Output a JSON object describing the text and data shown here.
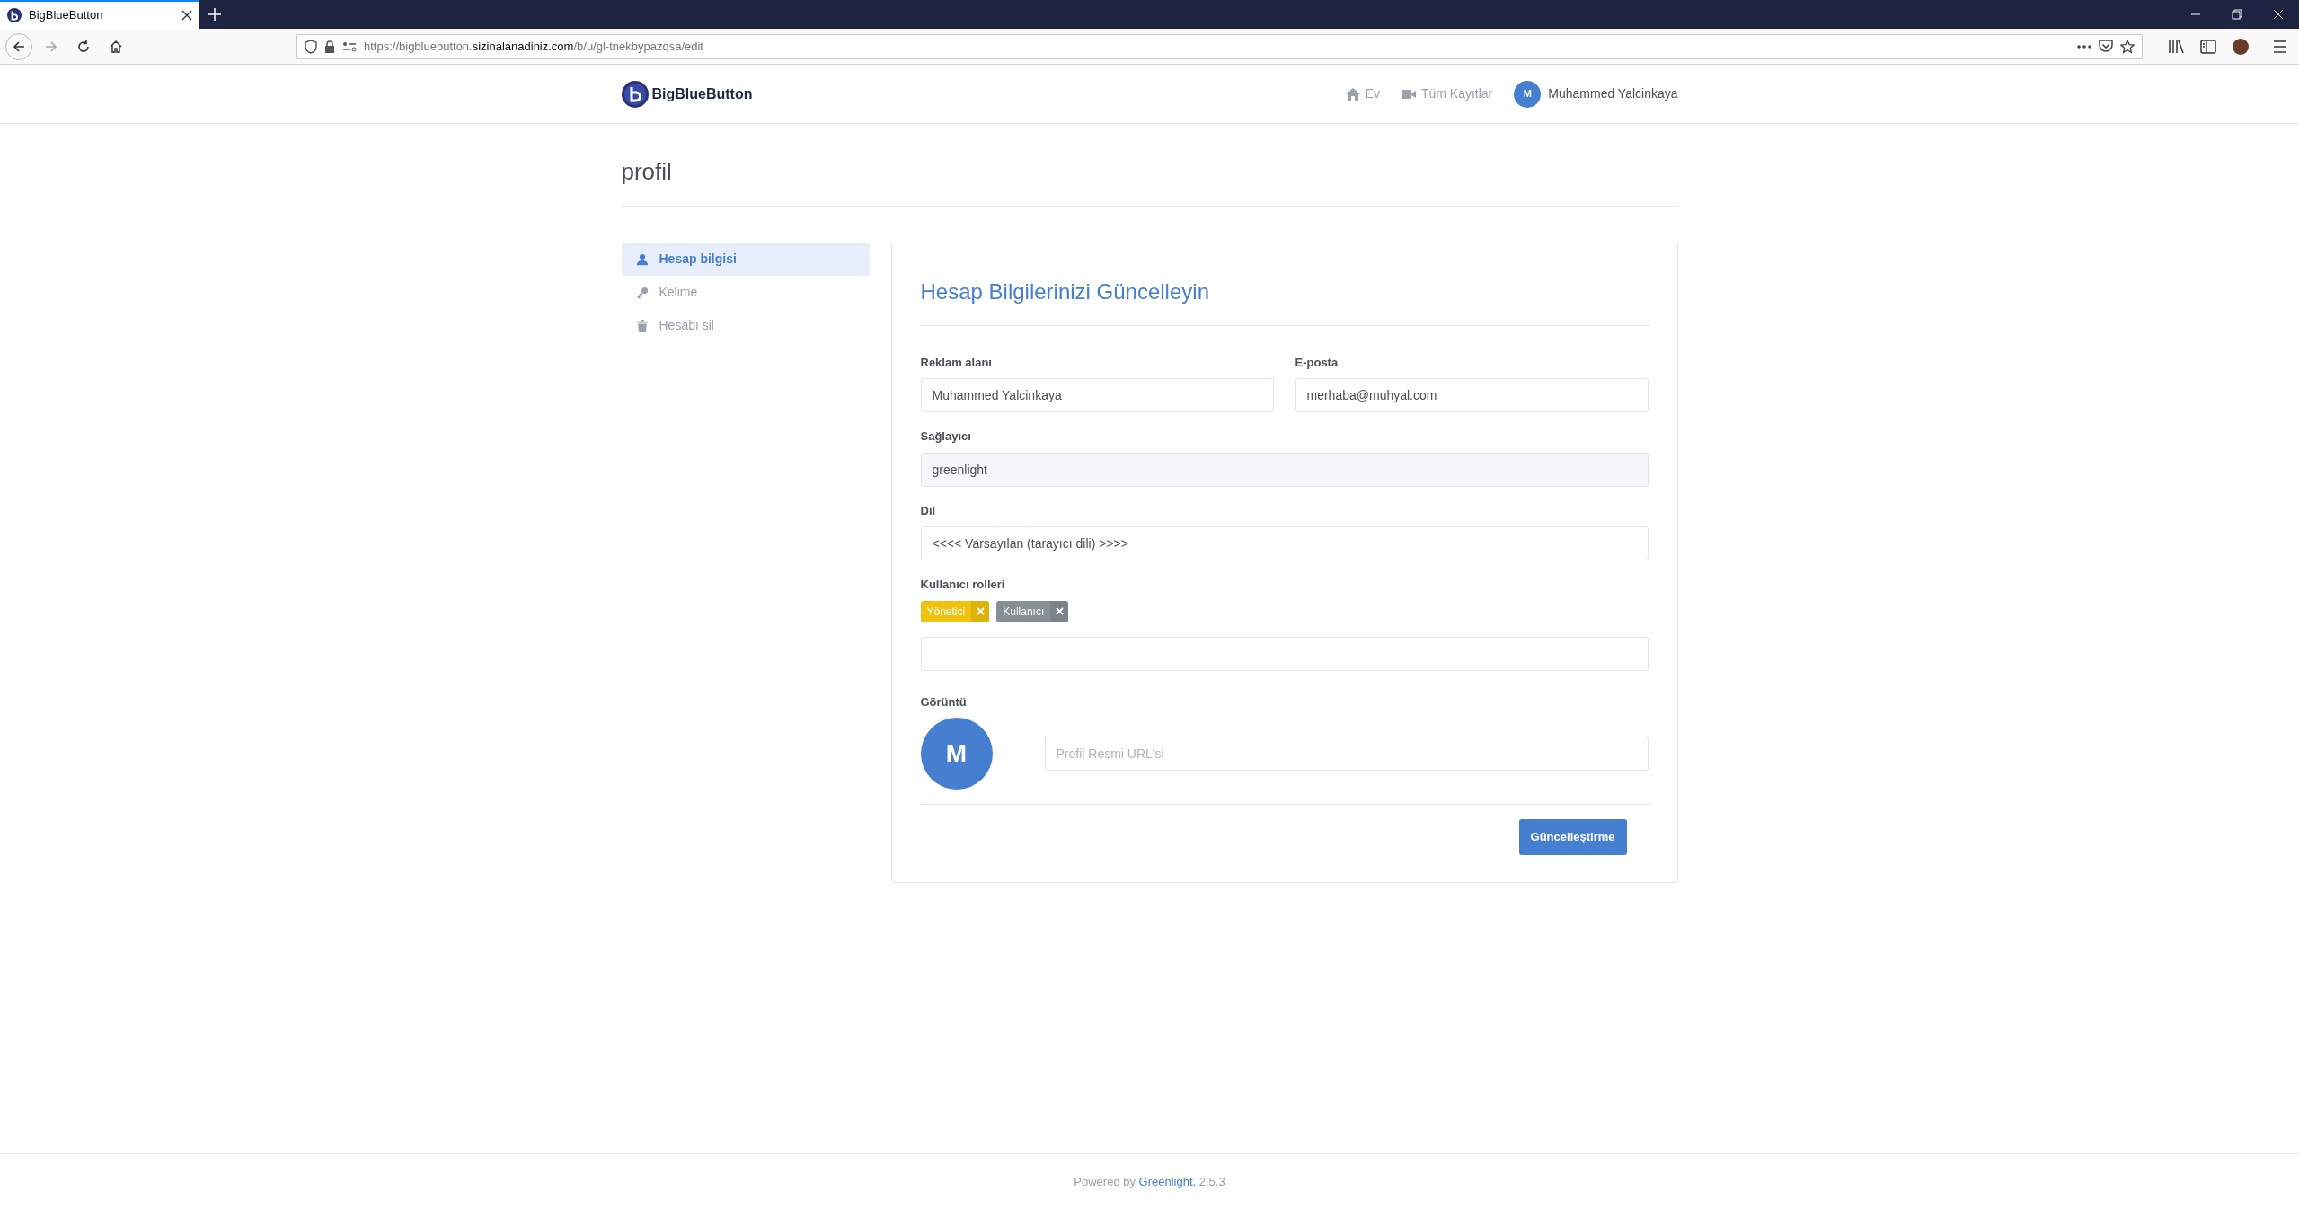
{
  "browser": {
    "tab_title": "BigBlueButton",
    "url": {
      "before": "https://bigbluebutton.",
      "domain": "sizinalanadiniz.com",
      "after": "/b/u/gl-tnekbypazqsa/edit"
    }
  },
  "navbar": {
    "brand": "BigBlueButton",
    "links": [
      {
        "label": "Ev"
      },
      {
        "label": "Tüm Kayıtlar"
      }
    ],
    "user": {
      "initial": "M",
      "name": "Muhammed Yalcinkaya"
    }
  },
  "page_title": "profil",
  "sidebar": {
    "items": [
      {
        "label": "Hesap bilgisi",
        "selected": true
      },
      {
        "label": "Kelime",
        "selected": false
      },
      {
        "label": "Hesabı sil",
        "selected": false
      }
    ]
  },
  "form": {
    "title": "Hesap Bilgilerinizi Güncelleyin",
    "rows": [
      [
        {
          "label": "Reklam alanı",
          "kind": "text",
          "value": "Muhammed Yalcinkaya"
        },
        {
          "label": "E-posta",
          "kind": "text",
          "value": "merhaba@muhyal.com"
        }
      ],
      [
        {
          "label": "Sağlayıcı",
          "kind": "readonly",
          "value": "greenlight"
        }
      ],
      [
        {
          "label": "Dil",
          "kind": "select",
          "value": "<<<< Varsayılan (tarayıcı dili) >>>>"
        }
      ]
    ],
    "roles": {
      "label": "Kullanıcı rolleri",
      "tags": [
        {
          "label": "Yönetici",
          "color": "#f0c20e"
        },
        {
          "label": "Kullanıcı",
          "color": "#868e96"
        }
      ]
    },
    "image": {
      "label": "Görüntü",
      "initial": "M",
      "placeholder": "Profil Resmi URL'si"
    },
    "submit": "Güncelleştirme"
  },
  "footer": {
    "prefix": "Powered by",
    "link": "Greenlight.",
    "version": "2.5.3"
  }
}
